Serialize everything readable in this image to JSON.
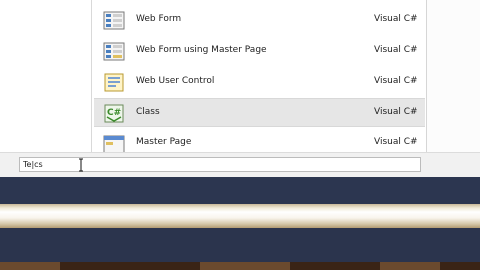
{
  "templates": [
    {
      "name": "Web Form",
      "language": "Visual C#",
      "icon": "web-form-icon",
      "selected": false
    },
    {
      "name": "Web Form using Master Page",
      "language": "Visual C#",
      "icon": "web-form-master-icon",
      "selected": false
    },
    {
      "name": "Web User Control",
      "language": "Visual C#",
      "icon": "web-user-control-icon",
      "selected": false
    },
    {
      "name": "Class",
      "language": "Visual C#",
      "icon": "csharp-class-icon",
      "selected": true
    },
    {
      "name": "Master Page",
      "language": "Visual C#",
      "icon": "master-page-icon",
      "selected": false
    }
  ],
  "name_field": {
    "value": "Te|cs"
  },
  "colors": {
    "selected_bg": "#e6e6e6",
    "panel": "#2c3650",
    "stripe": "#f0ead8"
  }
}
